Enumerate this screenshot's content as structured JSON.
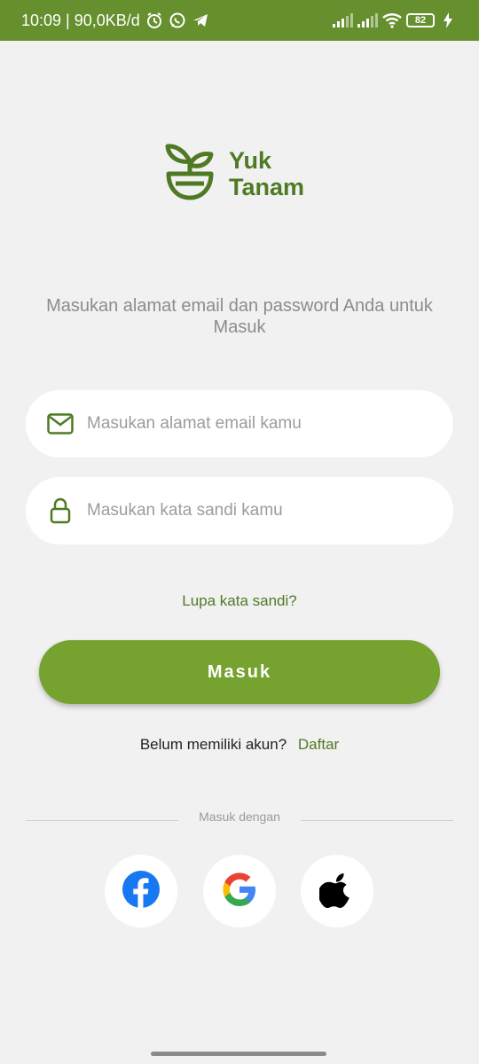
{
  "status_bar": {
    "time_and_speed": "10:09 | 90,0KB/d",
    "battery_level": "82",
    "icons": [
      "alarm-icon",
      "whatsapp-icon",
      "telegram-icon",
      "signal-icon",
      "signal-icon",
      "wifi-icon",
      "battery-icon",
      "charging-icon"
    ]
  },
  "brand": {
    "name_line1": "Yuk",
    "name_line2": "Tanam",
    "color": "#4f7a24"
  },
  "login": {
    "instruction": "Masukan alamat email dan password Anda untuk Masuk",
    "email_placeholder": "Masukan alamat email kamu",
    "password_placeholder": "Masukan kata sandi kamu",
    "forgot_label": "Lupa kata sandi?",
    "submit_label": "Masuk",
    "no_account_text": "Belum memiliki akun?",
    "register_label": "Daftar"
  },
  "social_login": {
    "divider_text": "Masuk dengan",
    "providers": [
      "facebook-icon",
      "google-icon",
      "apple-icon"
    ]
  },
  "colors": {
    "status_bar": "#668f2e",
    "accent": "#76a22f",
    "background": "#f1f1f1"
  }
}
